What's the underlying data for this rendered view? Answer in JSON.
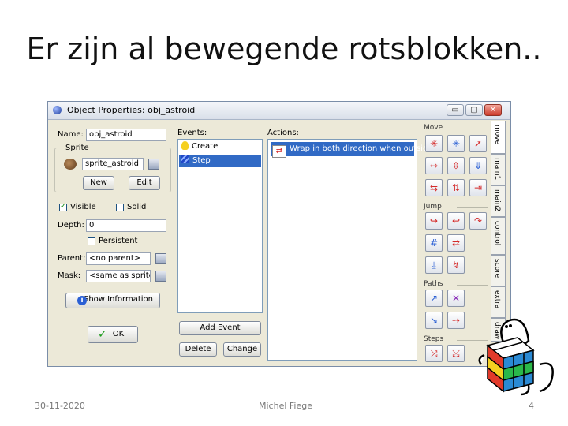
{
  "slide": {
    "title": "Er zijn al bewegende rotsblokken..",
    "date": "30-11-2020",
    "author": "Michel Fiege",
    "page_number": "4"
  },
  "window": {
    "title": "Object Properties: obj_astroid",
    "minimize": "▭",
    "maximize": "▢",
    "close": "✕"
  },
  "props": {
    "name_label": "Name:",
    "name_value": "obj_astroid",
    "sprite_group_label": "Sprite",
    "sprite_value": "sprite_astroid",
    "new_button": "New",
    "edit_button": "Edit",
    "visible_label": "Visible",
    "visible_checked": true,
    "solid_label": "Solid",
    "solid_checked": false,
    "depth_label": "Depth:",
    "depth_value": "0",
    "persistent_label": "Persistent",
    "persistent_checked": false,
    "parent_label": "Parent:",
    "parent_value": "<no parent>",
    "mask_label": "Mask:",
    "mask_value": "<same as sprite>",
    "show_information_button": "Show Information",
    "ok_button": "OK"
  },
  "events": {
    "label": "Events:",
    "items": [
      {
        "label": "Create",
        "icon": "lightbulb-icon",
        "selected": false
      },
      {
        "label": "Step",
        "icon": "footsteps-icon",
        "selected": true
      }
    ],
    "add_event_button": "Add Event",
    "delete_button": "Delete",
    "change_button": "Change"
  },
  "actions": {
    "label": "Actions:",
    "items": [
      {
        "label": "Wrap in both direction when outside",
        "icon": "wrap-icon",
        "selected": true
      }
    ]
  },
  "palette": {
    "sections": [
      "Move",
      "Jump",
      "Paths",
      "Steps"
    ],
    "tabs": [
      "move",
      "main1",
      "main2",
      "control",
      "score",
      "extra",
      "draw"
    ]
  },
  "colors": {
    "selection": "#316ac5",
    "window_bg": "#ece9d8",
    "icon_red": "#d42a2a",
    "icon_blue": "#2a5fd4"
  }
}
